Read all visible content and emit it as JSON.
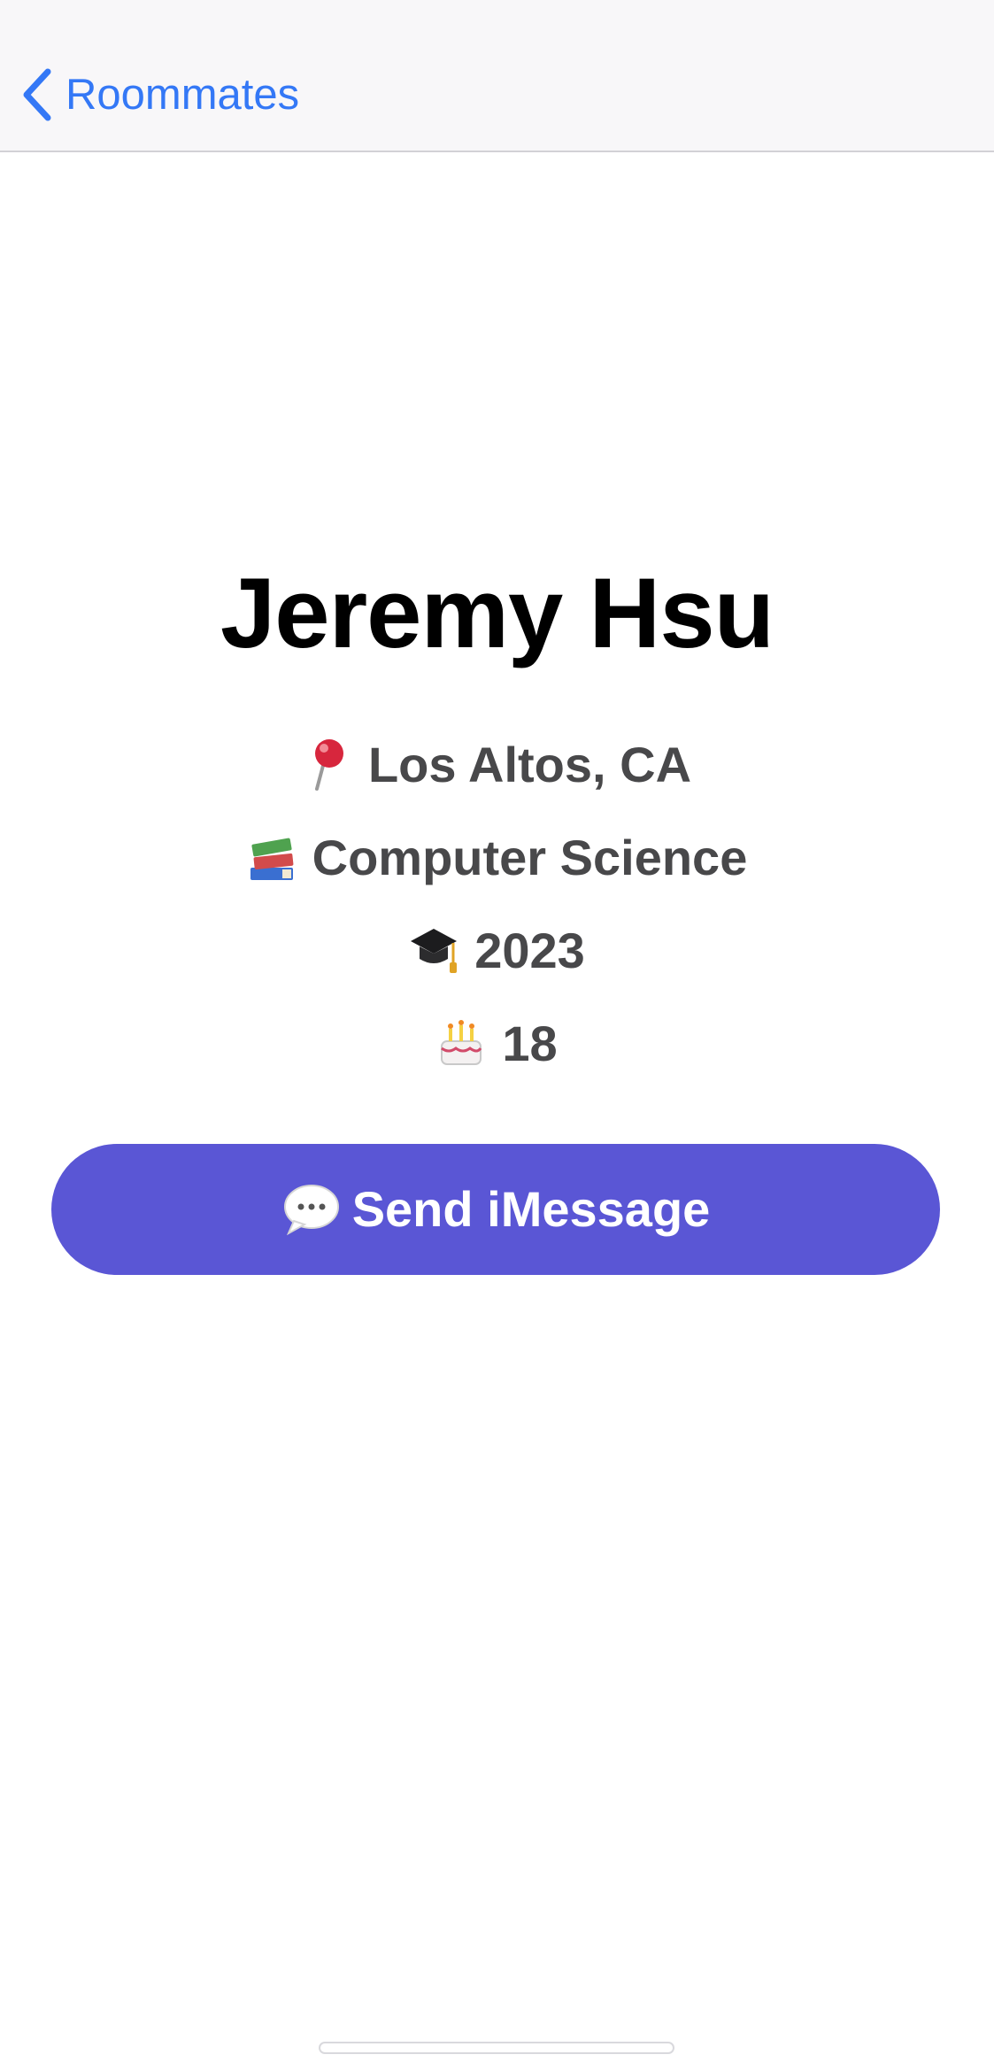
{
  "nav": {
    "back_label": "Roommates"
  },
  "profile": {
    "name": "Jeremy Hsu",
    "location": "Los Altos, CA",
    "major": "Computer Science",
    "class_year": "2023",
    "age": "18"
  },
  "icons": {
    "location": "round-pushpin-icon",
    "major": "books-icon",
    "class_year": "graduation-cap-icon",
    "age": "birthday-cake-icon",
    "send": "speech-balloon-icon",
    "back": "chevron-left-icon"
  },
  "actions": {
    "send_label": "Send iMessage"
  },
  "colors": {
    "accent_blue": "#3478f6",
    "button_purple": "#5a56d5",
    "nav_background": "#f8f7f9",
    "info_text": "#48484a"
  }
}
